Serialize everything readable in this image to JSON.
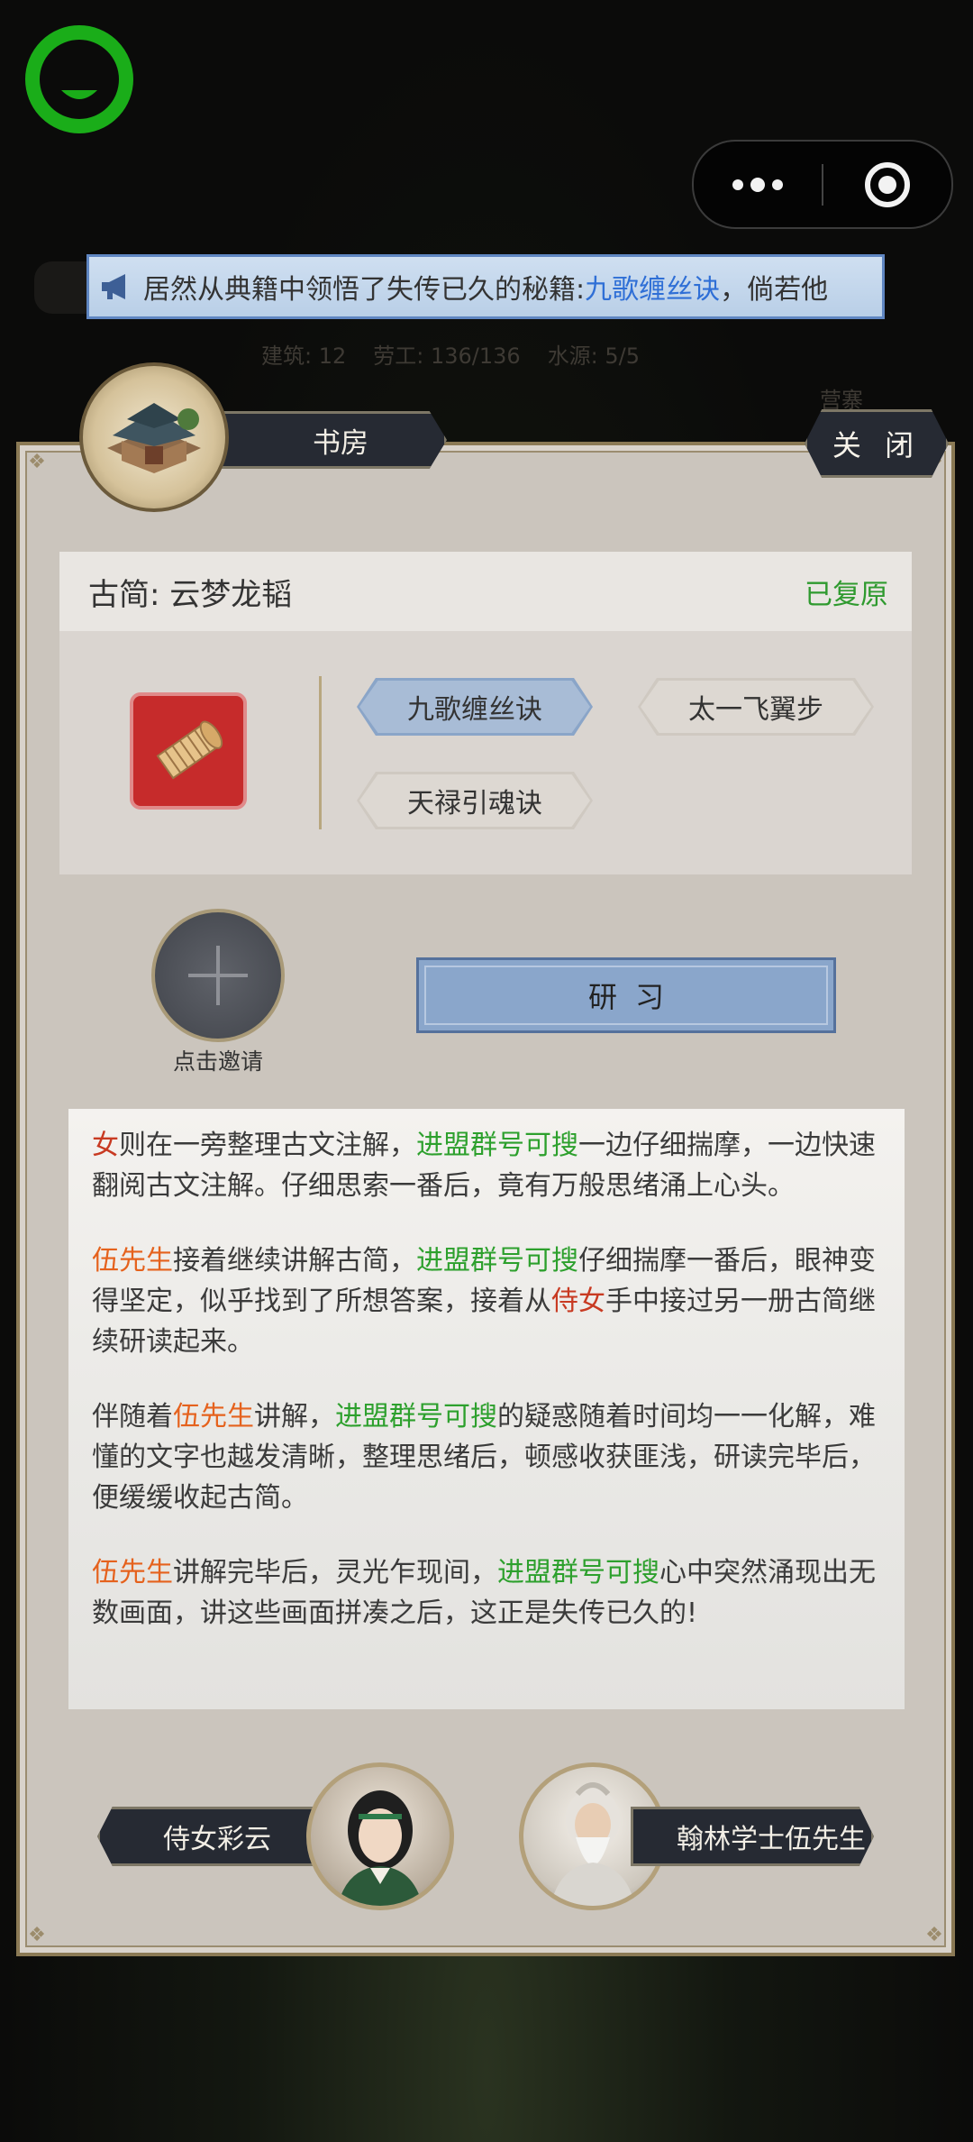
{
  "announcement": {
    "text_before": "居然从典籍中领悟了失传已久的秘籍:",
    "highlight": "九歌缠丝诀",
    "text_after": "，倘若他"
  },
  "background": {
    "stats": [
      "建筑: 12",
      "劳工: 136/136",
      "水源: 5/5"
    ],
    "right_label": "营寨"
  },
  "header": {
    "title": "书房",
    "close_label": "关 闭"
  },
  "book": {
    "name": "古简: 云梦龙韬",
    "status": "已复原",
    "skills": [
      {
        "label": "九歌缠丝诀",
        "selected": true
      },
      {
        "label": "太一飞翼步",
        "selected": false
      },
      {
        "label": "天禄引魂诀",
        "selected": false
      }
    ]
  },
  "invite": {
    "label": "点击邀请"
  },
  "study": {
    "label": "研习"
  },
  "story": {
    "p1": {
      "a": "女",
      "b": "则在一旁整理古文注解，",
      "c": "进盟群号可搜",
      "d": "一边仔细揣摩，一边快速翻阅古文注解。仔细思索一番后，竟有万般思绪涌上心头。"
    },
    "p2": {
      "a": "伍先生",
      "b": "接着继续讲解古简，",
      "c": "进盟群号可搜",
      "d": "仔细揣摩一番后，眼神变得坚定，似乎找到了所想答案，接着从",
      "e": "侍女",
      "f": "手中接过另一册古简继续研读起来。"
    },
    "p3": {
      "a": "伴随着",
      "b": "伍先生",
      "c": "讲解，",
      "d": "进盟群号可搜",
      "e": "的疑惑随着时间均一一化解，难懂的文字也越发清晰，整理思绪后，顿感收获匪浅，研读完毕后，便缓缓收起古简。"
    },
    "p4": {
      "a": "伍先生",
      "b": "讲解完毕后，灵光乍现间，",
      "c": "进盟群号可搜",
      "d": "心中突然涌现出无数画面，讲这些画面拼凑之后，这正是失传已久的!"
    }
  },
  "characters": {
    "left_name": "侍女彩云",
    "right_name": "翰林学士伍先生"
  },
  "colors": {
    "wechat_green": "#1aad19",
    "highlight_blue": "#2f6fd6",
    "status_green": "#2f9a2f",
    "name_orange": "#e5621d",
    "name_red": "#c83a22"
  }
}
